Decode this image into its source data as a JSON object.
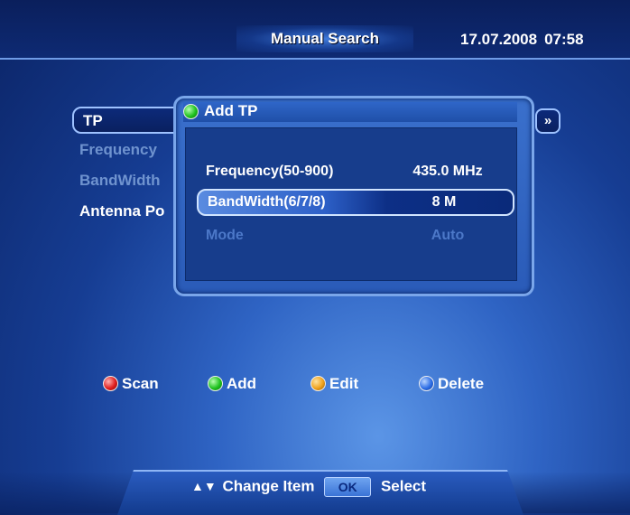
{
  "header": {
    "title": "Manual Search",
    "date": "17.07.2008",
    "time": "07:58"
  },
  "background_menu": {
    "items": [
      {
        "label": "TP",
        "state": "selected"
      },
      {
        "label": "Frequency",
        "state": "dim"
      },
      {
        "label": "BandWidth",
        "state": "dim"
      },
      {
        "label": "Antenna Po",
        "state": "normal"
      }
    ],
    "arrow": "»"
  },
  "dialog": {
    "title": "Add TP",
    "rows": [
      {
        "label": "Frequency(50-900)",
        "value": "435.0 MHz",
        "state": "normal"
      },
      {
        "label": "BandWidth(6/7/8)",
        "value": "8 M",
        "state": "selected"
      },
      {
        "label": "Mode",
        "value": "Auto",
        "state": "disabled"
      }
    ]
  },
  "color_keys": [
    {
      "color": "red",
      "label": "Scan"
    },
    {
      "color": "green",
      "label": "Add"
    },
    {
      "color": "orange",
      "label": "Edit"
    },
    {
      "color": "blue",
      "label": "Delete"
    }
  ],
  "footer": {
    "nav_arrows": "▲▼",
    "change_label": "Change Item",
    "ok_label": "OK",
    "select_label": "Select"
  },
  "colors": {
    "accent": "#7aa6ea",
    "dim_text": "#4c78c8",
    "background_dark": "#0b2466"
  }
}
